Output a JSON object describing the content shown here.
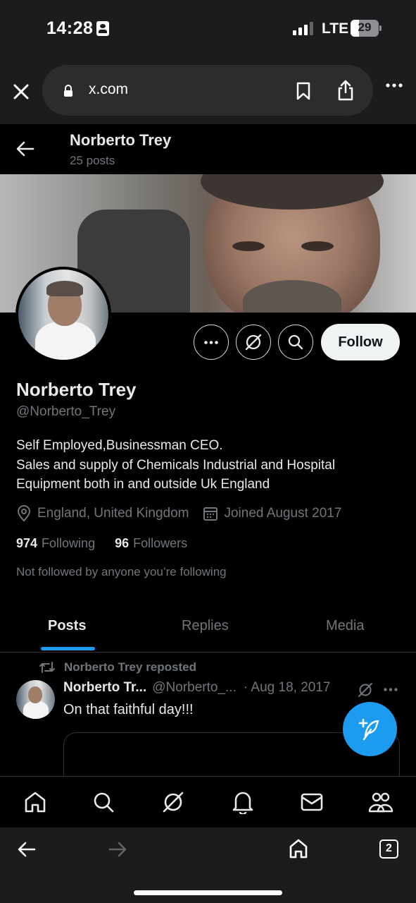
{
  "status_bar": {
    "time": "14:28",
    "network": "LTE",
    "battery_level": "29",
    "battery_fraction": 0.29
  },
  "browser": {
    "url": "x.com",
    "tab_count": "2"
  },
  "header": {
    "name": "Norberto Trey",
    "posts_count": "25 posts"
  },
  "profile": {
    "display_name": "Norberto Trey",
    "handle": "@Norberto_Trey",
    "bio_lines": [
      "Self Employed,Businessman CEO.",
      "Sales and supply of Chemicals Industrial and Hospital",
      "Equipment both in and outside Uk England"
    ],
    "location": "England, United Kingdom",
    "joined": "Joined August 2017",
    "following_count": "974",
    "following_label": "Following",
    "followers_count": "96",
    "followers_label": "Followers",
    "not_followed_text": "Not followed by anyone you’re following",
    "follow_button_label": "Follow"
  },
  "tabs": [
    {
      "label": "Posts",
      "active": true
    },
    {
      "label": "Replies",
      "active": false
    },
    {
      "label": "Media",
      "active": false
    }
  ],
  "post": {
    "repost_label": "Norberto Trey reposted",
    "author_name": "Norberto Tr...",
    "author_handle": "@Norberto_...",
    "date": "· Aug 18, 2017",
    "text": "On that faithful day!!!"
  },
  "icons": {
    "status": [
      "id-card-icon",
      "signal-icon",
      "battery-icon"
    ],
    "browser_bar": [
      "close-icon",
      "lock-icon",
      "bookmark-icon",
      "share-icon",
      "more-icon"
    ],
    "profile_actions": [
      "more-icon",
      "grok-icon",
      "search-icon"
    ],
    "bottom_nav": [
      "home-icon",
      "search-icon",
      "grok-icon",
      "notifications-icon",
      "messages-icon",
      "communities-icon"
    ],
    "browser_toolbar": [
      "back-arrow-icon",
      "forward-arrow-icon",
      "home-icon",
      "tabs-icon"
    ]
  },
  "colors": {
    "accent": "#1d9bf0",
    "background": "#000000",
    "secondary_text": "#71767b",
    "primary_text": "#e7e9ea",
    "browser_chrome": "#1c1c1e"
  }
}
